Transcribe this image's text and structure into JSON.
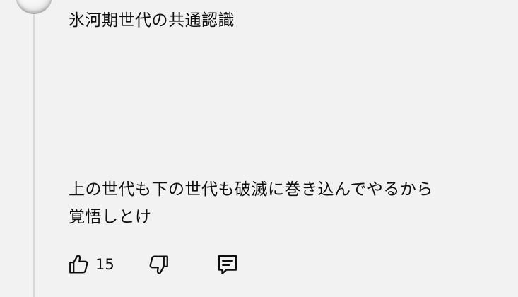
{
  "comment": {
    "lines": [
      "氷河期世代の共通認識",
      "上の世代も下の世代も破滅に巻き込んでやるから",
      "覚悟しとけ"
    ]
  },
  "actions": {
    "like_count": "15",
    "icons": [
      "thumbs-up-icon",
      "thumbs-down-icon",
      "reply-comment-icon"
    ]
  },
  "menu": {
    "icon": "more-vertical-icon"
  }
}
